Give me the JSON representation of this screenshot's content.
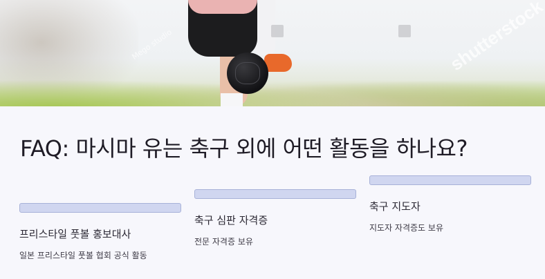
{
  "hero": {
    "image_name": "hero-photo",
    "watermarks": [
      "Mego studio",
      "shutterstock"
    ]
  },
  "faq": {
    "title": "FAQ: 마시마 유는 축구 외에 어떤 활동을 하나요?"
  },
  "activities": [
    {
      "title": "프리스타일 풋볼 홍보대사",
      "desc": "일본 프리스타일 풋볼 협회 공식 활동"
    },
    {
      "title": "축구 심판 자격증",
      "desc": "전문 자격증 보유"
    },
    {
      "title": "축구 지도자",
      "desc": "지도자 자격증도 보유"
    }
  ],
  "colors": {
    "page_bg": "#f7f7fc",
    "bar_fill": "#d0d6f0",
    "bar_border": "#a7b1d8",
    "title_text": "#1f1c26"
  }
}
